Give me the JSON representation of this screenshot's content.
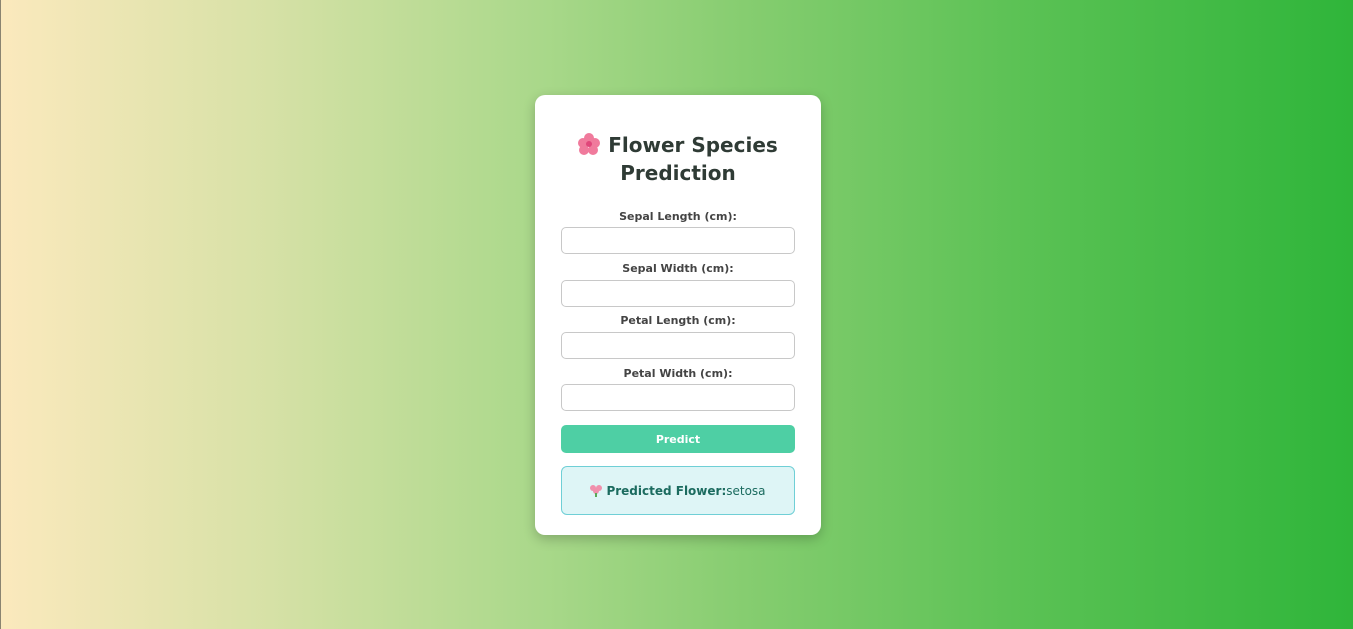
{
  "page": {
    "title_text": "Flower Species Prediction",
    "title_icon": "cherry-blossom-icon"
  },
  "form": {
    "fields": [
      {
        "label": "Sepal Length (cm):",
        "value": "",
        "placeholder": ""
      },
      {
        "label": "Sepal Width (cm):",
        "value": "",
        "placeholder": ""
      },
      {
        "label": "Petal Length (cm):",
        "value": "",
        "placeholder": ""
      },
      {
        "label": "Petal Width (cm):",
        "value": "",
        "placeholder": ""
      }
    ],
    "submit_label": "Predict"
  },
  "result": {
    "icon": "flower-icon",
    "label": "Predicted Flower:",
    "value": "setosa"
  },
  "colors": {
    "button": "#4ecfa4",
    "result_bg": "#def5f6",
    "result_border": "#6fcfd6",
    "gradient_start": "#fbe9bd",
    "gradient_end": "#2fb53a"
  }
}
